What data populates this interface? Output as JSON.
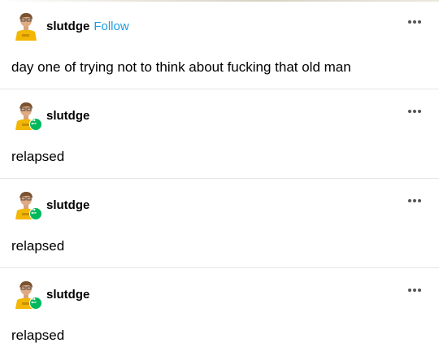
{
  "original_post": {
    "username": "slutdge",
    "follow_label": "Follow",
    "text": "day one of trying not to think about fucking that old man"
  },
  "reblogs": [
    {
      "username": "slutdge",
      "text": "relapsed"
    },
    {
      "username": "slutdge",
      "text": "relapsed"
    },
    {
      "username": "slutdge",
      "text": "relapsed"
    }
  ],
  "icons": {
    "more": "more-options-icon",
    "reblog": "reblog-icon",
    "avatar": "avatar"
  },
  "colors": {
    "follow": "#1d9be0",
    "reblog_badge": "#00b85c",
    "avatar_shirt": "#f2b705"
  }
}
